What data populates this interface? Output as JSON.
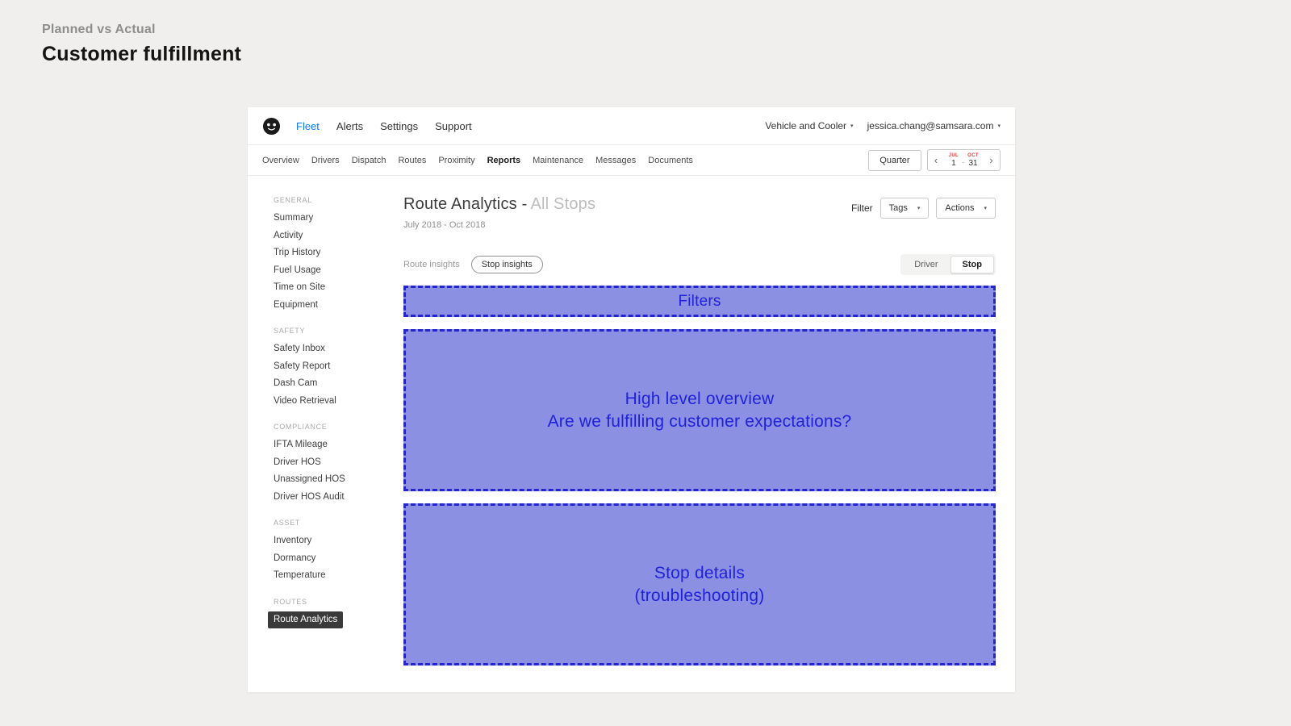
{
  "page": {
    "kicker": "Planned vs Actual",
    "title": "Customer fulfillment"
  },
  "icons": {
    "caret_down": "▾",
    "chevron_left": "‹",
    "chevron_right": "›"
  },
  "topnav": {
    "items": [
      "Fleet",
      "Alerts",
      "Settings",
      "Support"
    ],
    "org": "Vehicle and Cooler",
    "account": "jessica.chang@samsara.com"
  },
  "subnav": {
    "items": [
      "Overview",
      "Drivers",
      "Dispatch",
      "Routes",
      "Proximity",
      "Reports",
      "Maintenance",
      "Messages",
      "Documents"
    ],
    "period_label": "Quarter",
    "range": {
      "start_month": "JUL",
      "start_day": "1",
      "separator": "-",
      "end_month": "OCT",
      "end_day": "31"
    }
  },
  "sidebar": {
    "sections": [
      {
        "heading": "GENERAL",
        "items": [
          "Summary",
          "Activity",
          "Trip History",
          "Fuel Usage",
          "Time on Site",
          "Equipment"
        ]
      },
      {
        "heading": "SAFETY",
        "items": [
          "Safety Inbox",
          "Safety Report",
          "Dash Cam",
          "Video Retrieval"
        ]
      },
      {
        "heading": "COMPLIANCE",
        "items": [
          "IFTA Mileage",
          "Driver HOS",
          "Unassigned HOS",
          "Driver HOS Audit"
        ]
      },
      {
        "heading": "ASSET",
        "items": [
          "Inventory",
          "Dormancy",
          "Temperature"
        ]
      },
      {
        "heading": "ROUTES",
        "items": [
          "Route Analytics"
        ],
        "active_item": "Route Analytics"
      }
    ]
  },
  "content": {
    "title_main": "Route Analytics -",
    "title_muted": "All Stops",
    "subtitle": "July 2018 - Oct 2018",
    "filter_label": "Filter",
    "tags_label": "Tags",
    "actions_label": "Actions",
    "tabs": [
      "Route insights",
      "Stop insights"
    ],
    "active_tab": "Stop insights",
    "view_toggle": [
      "Driver",
      "Stop"
    ],
    "active_view": "Stop",
    "wireframes": [
      {
        "lines": [
          "Filters"
        ]
      },
      {
        "lines": [
          "High level overview",
          "Are we fulfilling customer expectations?"
        ]
      },
      {
        "lines": [
          "Stop details",
          "(troubleshooting)"
        ]
      }
    ]
  },
  "colors": {
    "page_background": "#f0efed",
    "accent_blue": "#0a7af5",
    "wireframe_border": "#2425cf",
    "wireframe_fill": "#8c90e3",
    "wireframe_text": "#1f22d8",
    "month_red": "#e03e3e",
    "active_sidebar_bg": "#3a3a3a"
  }
}
